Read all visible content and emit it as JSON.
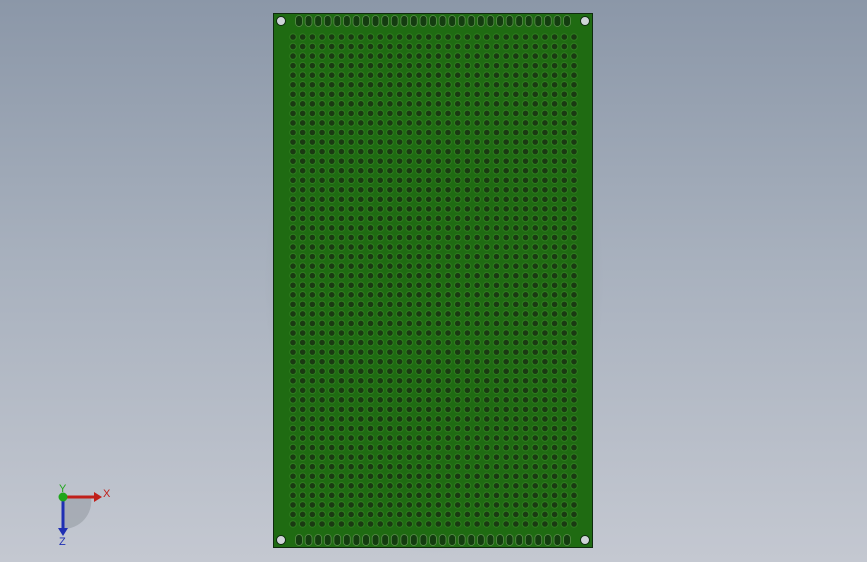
{
  "viewport": {
    "background_top": "#8b97a8",
    "background_bottom": "#c4c8d1"
  },
  "pcb": {
    "board_color": "#1f6b12",
    "board_edge_color": "#0e2a0e",
    "hole_color": "#1a3a12",
    "pad_color": "#2f7d1f",
    "slot_color": "#143d10",
    "grid_columns": 30,
    "grid_rows": 52,
    "edge_slots": 29
  },
  "triad": {
    "x_label": "X",
    "y_label": "Y",
    "z_label": "Z",
    "x_color": "#c0201a",
    "y_color": "#1fa61a",
    "z_color": "#1f2fb3"
  }
}
